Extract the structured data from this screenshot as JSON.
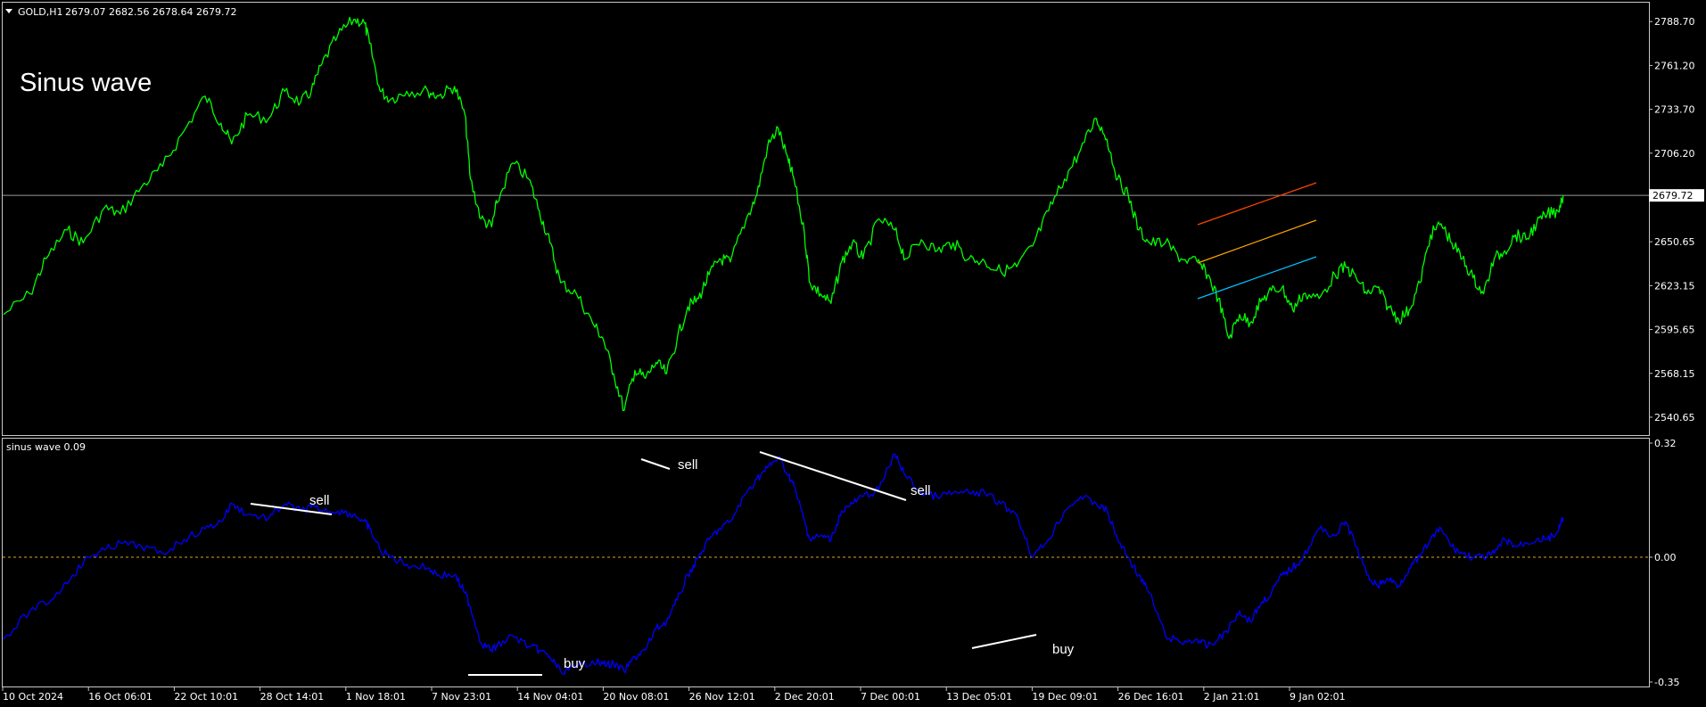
{
  "header": {
    "symbol": "GOLD,H1",
    "ohlc": "2679.07 2682.56 2678.64 2679.72",
    "overlay_title": "Sinus wave"
  },
  "colors": {
    "background": "#000000",
    "frame": "#c8c8c8",
    "price_line": "#00ff00",
    "indicator_line": "#0000ff",
    "zero_line": "#daa520",
    "annotation": "#ffffff",
    "channel_upper": "#ff4500",
    "channel_mid": "#ffa500",
    "channel_lower": "#00bfff"
  },
  "chart_data": [
    {
      "type": "line",
      "name": "main",
      "current_price_label": "2679.72",
      "y_ticks": [
        "2788.70",
        "2761.20",
        "2733.70",
        "2706.20",
        "2650.65",
        "2623.15",
        "2595.65",
        "2568.15",
        "2540.65"
      ],
      "ylim": [
        2530.0,
        2800.0
      ],
      "current_price": 2679.72,
      "x_ticks": [
        "10 Oct 2024",
        "16 Oct 06:01",
        "22 Oct 10:01",
        "28 Oct 14:01",
        "1 Nov 18:01",
        "7 Nov 23:01",
        "14 Nov 04:01",
        "20 Nov 08:01",
        "26 Nov 12:01",
        "2 Dec 20:01",
        "7 Dec 00:01",
        "13 Dec 05:01",
        "19 Dec 09:01",
        "26 Dec 16:01",
        "2 Jan 21:01",
        "9 Jan 02:01"
      ],
      "series": [
        {
          "points": [
            [
              0,
              2605
            ],
            [
              5,
              2618
            ],
            [
              8,
              2640
            ],
            [
              12,
              2658
            ],
            [
              15,
              2650
            ],
            [
              19,
              2672
            ],
            [
              22,
              2668
            ],
            [
              26,
              2685
            ],
            [
              30,
              2698
            ],
            [
              34,
              2720
            ],
            [
              38,
              2742
            ],
            [
              41,
              2725
            ],
            [
              43,
              2712
            ],
            [
              46,
              2730
            ],
            [
              50,
              2728
            ],
            [
              53,
              2745
            ],
            [
              56,
              2738
            ],
            [
              58,
              2745
            ],
            [
              60,
              2762
            ],
            [
              63,
              2780
            ],
            [
              66,
              2790
            ],
            [
              68,
              2788
            ],
            [
              69,
              2775
            ],
            [
              71,
              2745
            ],
            [
              73,
              2740
            ],
            [
              76,
              2745
            ],
            [
              80,
              2745
            ],
            [
              82,
              2742
            ],
            [
              85,
              2748
            ],
            [
              87,
              2730
            ],
            [
              88,
              2690
            ],
            [
              90,
              2665
            ],
            [
              92,
              2660
            ],
            [
              93,
              2675
            ],
            [
              96,
              2700
            ],
            [
              99,
              2690
            ],
            [
              101,
              2670
            ],
            [
              103,
              2650
            ],
            [
              105,
              2625
            ],
            [
              108,
              2618
            ],
            [
              111,
              2600
            ],
            [
              113,
              2590
            ],
            [
              115,
              2568
            ],
            [
              117,
              2545
            ],
            [
              119,
              2570
            ],
            [
              121,
              2565
            ],
            [
              123,
              2575
            ],
            [
              125,
              2568
            ],
            [
              127,
              2590
            ],
            [
              129,
              2610
            ],
            [
              131,
              2615
            ],
            [
              133,
              2630
            ],
            [
              135,
              2640
            ],
            [
              137,
              2638
            ],
            [
              140,
              2665
            ],
            [
              142,
              2680
            ],
            [
              144,
              2710
            ],
            [
              146,
              2722
            ],
            [
              148,
              2700
            ],
            [
              149,
              2690
            ],
            [
              151,
              2655
            ],
            [
              152,
              2625
            ],
            [
              154,
              2618
            ],
            [
              156,
              2612
            ],
            [
              158,
              2638
            ],
            [
              160,
              2650
            ],
            [
              162,
              2640
            ],
            [
              165,
              2665
            ],
            [
              168,
              2658
            ],
            [
              170,
              2640
            ],
            [
              173,
              2652
            ],
            [
              176,
              2645
            ],
            [
              179,
              2650
            ],
            [
              182,
              2640
            ],
            [
              185,
              2638
            ],
            [
              188,
              2632
            ],
            [
              191,
              2635
            ],
            [
              194,
              2648
            ],
            [
              197,
              2670
            ],
            [
              200,
              2690
            ],
            [
              203,
              2708
            ],
            [
              206,
              2728
            ],
            [
              208,
              2715
            ],
            [
              210,
              2690
            ],
            [
              212,
              2680
            ],
            [
              214,
              2658
            ],
            [
              216,
              2650
            ],
            [
              219,
              2650
            ],
            [
              222,
              2640
            ],
            [
              225,
              2638
            ],
            [
              227,
              2630
            ],
            [
              229,
              2615
            ],
            [
              231,
              2590
            ],
            [
              233,
              2605
            ],
            [
              235,
              2600
            ],
            [
              237,
              2613
            ],
            [
              239,
              2620
            ],
            [
              241,
              2622
            ],
            [
              243,
              2608
            ],
            [
              245,
              2618
            ],
            [
              248,
              2615
            ],
            [
              251,
              2630
            ],
            [
              253,
              2635
            ],
            [
              255,
              2628
            ],
            [
              257,
              2618
            ],
            [
              259,
              2622
            ],
            [
              261,
              2610
            ],
            [
              263,
              2602
            ],
            [
              265,
              2608
            ],
            [
              267,
              2625
            ],
            [
              269,
              2655
            ],
            [
              271,
              2662
            ],
            [
              273,
              2650
            ],
            [
              275,
              2640
            ],
            [
              277,
              2628
            ],
            [
              279,
              2618
            ],
            [
              281,
              2640
            ],
            [
              283,
              2645
            ],
            [
              285,
              2655
            ],
            [
              287,
              2652
            ],
            [
              289,
              2662
            ],
            [
              291,
              2668
            ],
            [
              293,
              2670
            ],
            [
              294,
              2680
            ]
          ]
        }
      ],
      "annotations": [
        "Sinus wave"
      ]
    },
    {
      "type": "line",
      "name": "sub",
      "indicator_label": "sinus wave 0.09",
      "y_ticks": [
        "0.32",
        "0.00",
        "-0.35"
      ],
      "ylim": [
        -0.36,
        0.33
      ],
      "zero_value": 0.0,
      "series": [
        {
          "points": [
            [
              0,
              -0.23
            ],
            [
              5,
              -0.15
            ],
            [
              9,
              -0.12
            ],
            [
              13,
              -0.05
            ],
            [
              16,
              0.0
            ],
            [
              19,
              0.02
            ],
            [
              22,
              0.04
            ],
            [
              26,
              0.03
            ],
            [
              30,
              0.01
            ],
            [
              34,
              0.05
            ],
            [
              38,
              0.08
            ],
            [
              41,
              0.1
            ],
            [
              43,
              0.15
            ],
            [
              46,
              0.12
            ],
            [
              50,
              0.11
            ],
            [
              53,
              0.15
            ],
            [
              56,
              0.13
            ],
            [
              58,
              0.14
            ],
            [
              60,
              0.13
            ],
            [
              63,
              0.13
            ],
            [
              66,
              0.12
            ],
            [
              68,
              0.1
            ],
            [
              69,
              0.08
            ],
            [
              71,
              0.02
            ],
            [
              73,
              0.0
            ],
            [
              76,
              -0.02
            ],
            [
              80,
              -0.03
            ],
            [
              82,
              -0.05
            ],
            [
              85,
              -0.05
            ],
            [
              87,
              -0.1
            ],
            [
              88,
              -0.14
            ],
            [
              90,
              -0.24
            ],
            [
              92,
              -0.26
            ],
            [
              93,
              -0.25
            ],
            [
              96,
              -0.22
            ],
            [
              99,
              -0.25
            ],
            [
              101,
              -0.26
            ],
            [
              103,
              -0.28
            ],
            [
              105,
              -0.32
            ],
            [
              108,
              -0.31
            ],
            [
              111,
              -0.29
            ],
            [
              113,
              -0.3
            ],
            [
              115,
              -0.3
            ],
            [
              117,
              -0.32
            ],
            [
              119,
              -0.28
            ],
            [
              121,
              -0.26
            ],
            [
              123,
              -0.2
            ],
            [
              125,
              -0.18
            ],
            [
              127,
              -0.12
            ],
            [
              129,
              -0.05
            ],
            [
              131,
              0.0
            ],
            [
              133,
              0.05
            ],
            [
              135,
              0.08
            ],
            [
              137,
              0.1
            ],
            [
              140,
              0.18
            ],
            [
              142,
              0.22
            ],
            [
              144,
              0.25
            ],
            [
              146,
              0.28
            ],
            [
              148,
              0.23
            ],
            [
              149,
              0.2
            ],
            [
              151,
              0.1
            ],
            [
              152,
              0.05
            ],
            [
              154,
              0.06
            ],
            [
              156,
              0.05
            ],
            [
              158,
              0.13
            ],
            [
              160,
              0.15
            ],
            [
              162,
              0.17
            ],
            [
              165,
              0.19
            ],
            [
              168,
              0.29
            ],
            [
              170,
              0.23
            ],
            [
              173,
              0.18
            ],
            [
              176,
              0.17
            ],
            [
              179,
              0.18
            ],
            [
              182,
              0.18
            ],
            [
              185,
              0.18
            ],
            [
              188,
              0.15
            ],
            [
              191,
              0.12
            ],
            [
              194,
              0.0
            ],
            [
              197,
              0.05
            ],
            [
              200,
              0.13
            ],
            [
              203,
              0.17
            ],
            [
              206,
              0.15
            ],
            [
              208,
              0.13
            ],
            [
              210,
              0.05
            ],
            [
              212,
              0.0
            ],
            [
              214,
              -0.05
            ],
            [
              216,
              -0.1
            ],
            [
              219,
              -0.22
            ],
            [
              222,
              -0.24
            ],
            [
              225,
              -0.23
            ],
            [
              227,
              -0.25
            ],
            [
              229,
              -0.23
            ],
            [
              231,
              -0.2
            ],
            [
              233,
              -0.15
            ],
            [
              235,
              -0.18
            ],
            [
              237,
              -0.13
            ],
            [
              239,
              -0.1
            ],
            [
              241,
              -0.05
            ],
            [
              243,
              -0.03
            ],
            [
              245,
              0.0
            ],
            [
              248,
              0.08
            ],
            [
              251,
              0.06
            ],
            [
              253,
              0.1
            ],
            [
              255,
              0.03
            ],
            [
              257,
              -0.05
            ],
            [
              259,
              -0.08
            ],
            [
              261,
              -0.06
            ],
            [
              263,
              -0.08
            ],
            [
              265,
              -0.03
            ],
            [
              267,
              0.0
            ],
            [
              269,
              0.05
            ],
            [
              271,
              0.08
            ],
            [
              273,
              0.03
            ],
            [
              275,
              0.01
            ],
            [
              277,
              0.0
            ],
            [
              279,
              0.0
            ],
            [
              281,
              0.01
            ],
            [
              283,
              0.05
            ],
            [
              285,
              0.03
            ],
            [
              287,
              0.04
            ],
            [
              289,
              0.05
            ],
            [
              291,
              0.05
            ],
            [
              293,
              0.07
            ],
            [
              294,
              0.11
            ]
          ]
        }
      ],
      "annotations": [
        {
          "text": "sell",
          "kind": "sell"
        },
        {
          "text": "buy",
          "kind": "buy"
        },
        {
          "text": "sell",
          "kind": "sell"
        },
        {
          "text": "sell",
          "kind": "sell"
        },
        {
          "text": "buy",
          "kind": "buy"
        }
      ]
    }
  ]
}
